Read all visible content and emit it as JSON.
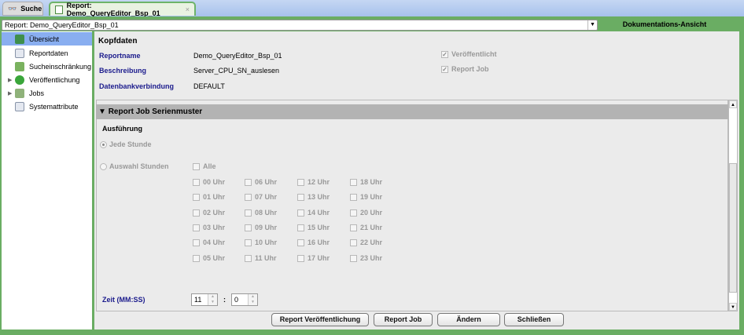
{
  "tabs": [
    {
      "label": "Suche"
    },
    {
      "label": "Report: Demo_QueryEditor_Bsp_01",
      "close": "×"
    }
  ],
  "selector": {
    "value": "Report: Demo_QueryEditor_Bsp_01"
  },
  "view_label": "Dokumentations-Ansicht",
  "sidebar": {
    "items": [
      {
        "label": "Übersicht"
      },
      {
        "label": "Reportdaten"
      },
      {
        "label": "Sucheinschränkung"
      },
      {
        "label": "Veröffentlichung"
      },
      {
        "label": "Jobs"
      },
      {
        "label": "Systemattribute"
      }
    ]
  },
  "kopfdaten": {
    "title": "Kopfdaten",
    "reportname_label": "Reportname",
    "reportname": "Demo_QueryEditor_Bsp_01",
    "beschreibung_label": "Beschreibung",
    "beschreibung": "Server_CPU_SN_auslesen",
    "db_label": "Datenbankverbindung",
    "db": "DEFAULT",
    "veroeffentlicht": "Veröffentlicht",
    "report_job": "Report Job"
  },
  "serien": {
    "title": "Report Job Serienmuster",
    "ausfuehrung": "Ausführung",
    "jede_stunde": "Jede Stunde",
    "auswahl": "Auswahl Stunden",
    "alle": "Alle",
    "hours": [
      "00 Uhr",
      "01 Uhr",
      "02 Uhr",
      "03 Uhr",
      "04 Uhr",
      "05 Uhr",
      "06 Uhr",
      "07 Uhr",
      "08 Uhr",
      "09 Uhr",
      "10 Uhr",
      "11 Uhr",
      "12 Uhr",
      "13 Uhr",
      "14 Uhr",
      "15 Uhr",
      "16 Uhr",
      "17 Uhr",
      "18 Uhr",
      "19 Uhr",
      "20 Uhr",
      "21 Uhr",
      "22 Uhr",
      "23 Uhr"
    ],
    "zeit_label": "Zeit (MM:SS)",
    "minutes": "11",
    "sep": ":",
    "seconds": "0"
  },
  "buttons": {
    "publish": "Report Veröffentlichung",
    "job": "Report Job",
    "change": "Ändern",
    "close": "Schließen"
  }
}
